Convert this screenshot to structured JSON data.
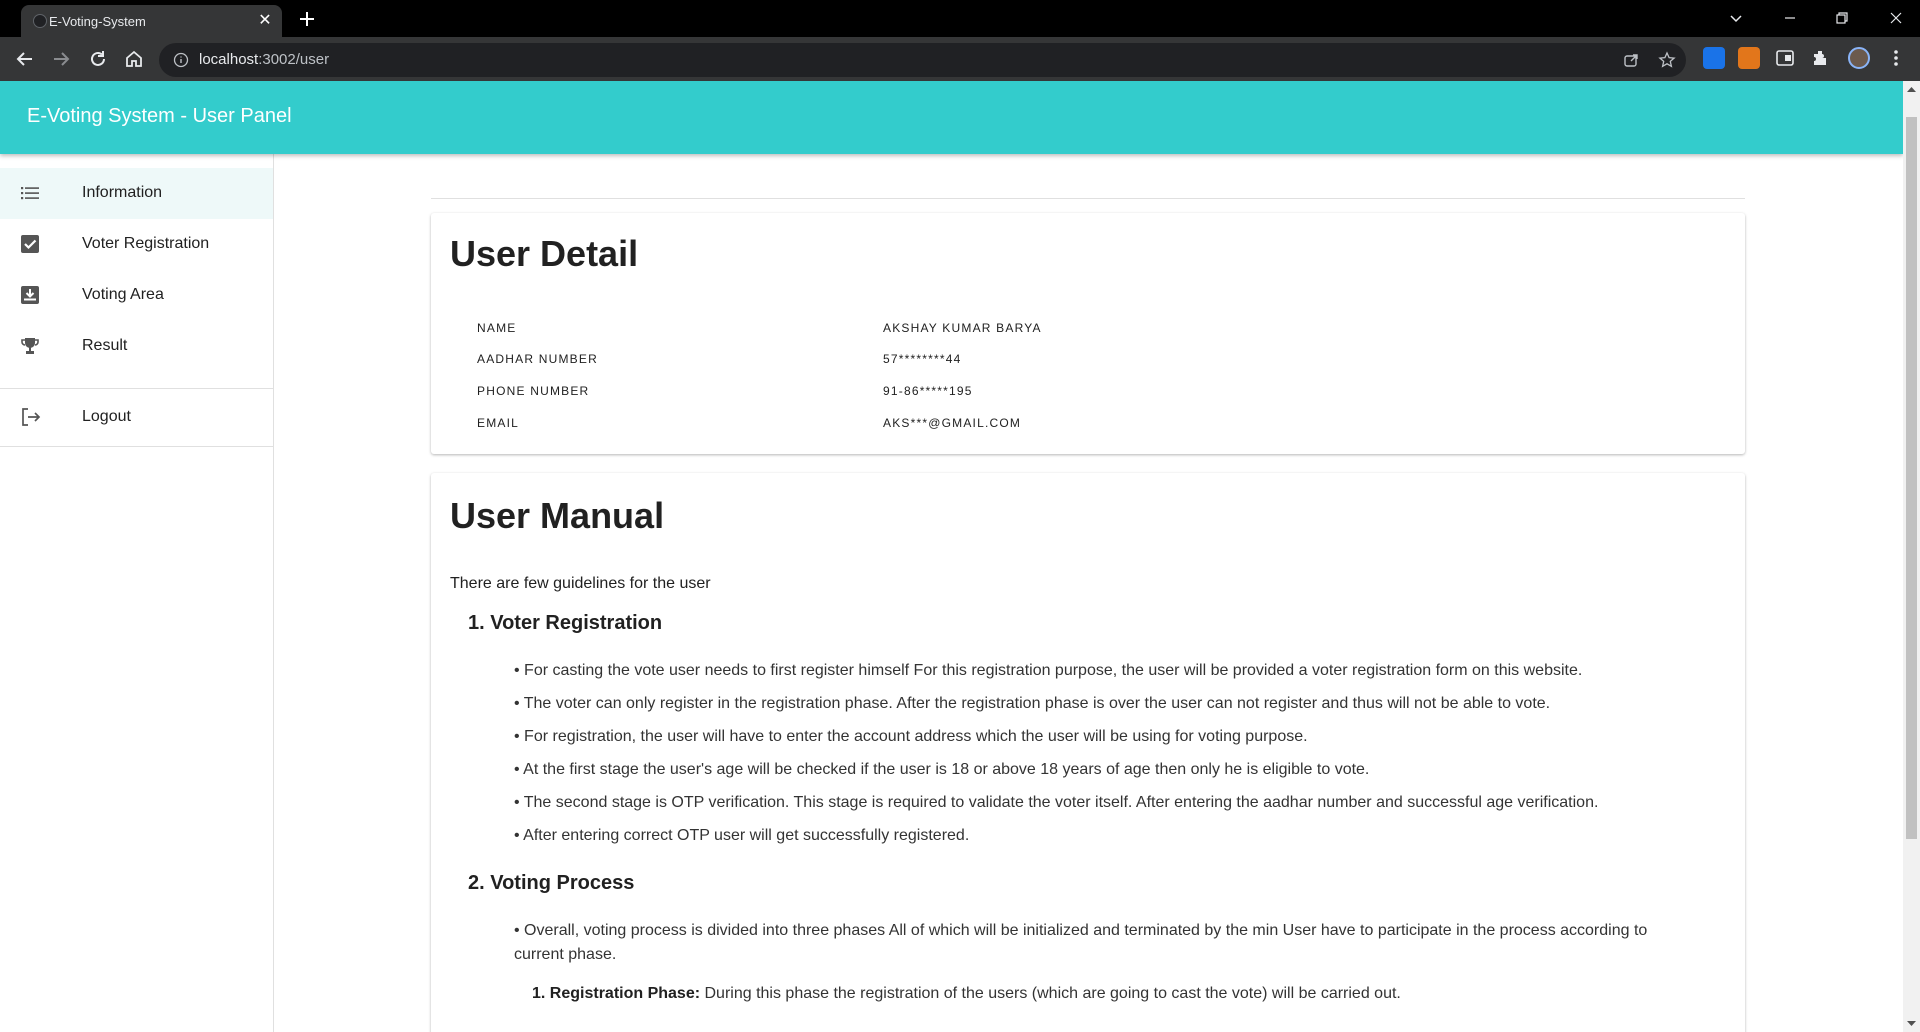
{
  "browser": {
    "tab_title": "E-Voting-System",
    "tab_close": "✕",
    "url_host": "localhost",
    "url_rest": ":3002/user"
  },
  "app": {
    "title": "E-Voting System - User Panel",
    "accent": "#33cccc"
  },
  "sidebar": {
    "items": [
      {
        "label": "Information",
        "icon": "list-icon",
        "active": true
      },
      {
        "label": "Voter Registration",
        "icon": "checkbox-icon"
      },
      {
        "label": "Voting Area",
        "icon": "ballot-box-icon"
      },
      {
        "label": "Result",
        "icon": "trophy-icon"
      }
    ],
    "logout": {
      "label": "Logout",
      "icon": "logout-icon"
    }
  },
  "user_detail": {
    "title": "User Detail",
    "rows": [
      {
        "key": "NAME",
        "value": "AKSHAY KUMAR BARYA"
      },
      {
        "key": "AADHAR NUMBER",
        "value": "57********44"
      },
      {
        "key": "PHONE NUMBER",
        "value": "91-86*****195"
      },
      {
        "key": "EMAIL",
        "value": "AKS***@GMAIL.COM"
      }
    ]
  },
  "user_manual": {
    "title": "User Manual",
    "intro": "There are few guidelines for the user",
    "section1": {
      "heading": "1. Voter Registration",
      "bullets": [
        "• For casting the vote user needs to first register himself For this registration purpose, the user will be provided a voter registration form on this website.",
        "• The voter can only register in the registration phase. After the registration phase is over the user can not register and thus will not be able to vote.",
        "• For registration, the user will have to enter the account address which the user will be using for voting purpose.",
        "• At the first stage the user's age will be checked if the user is 18 or above 18 years of age then only he is eligible to vote.",
        "• The second stage is OTP verification. This stage is required to validate the voter itself. After entering the aadhar number and successful age verification.",
        "• After entering correct OTP user will get successfully registered."
      ]
    },
    "section2": {
      "heading": "2. Voting Process",
      "bullets": [
        "• Overall, voting process is divided into three phases All of which will be initialized and terminated by the min User have to participate in the process according to current phase."
      ],
      "phase1_label": "1. Registration Phase:",
      "phase1_text": " During this phase the registration of the users (which are going to cast the vote) will be carried out."
    }
  }
}
